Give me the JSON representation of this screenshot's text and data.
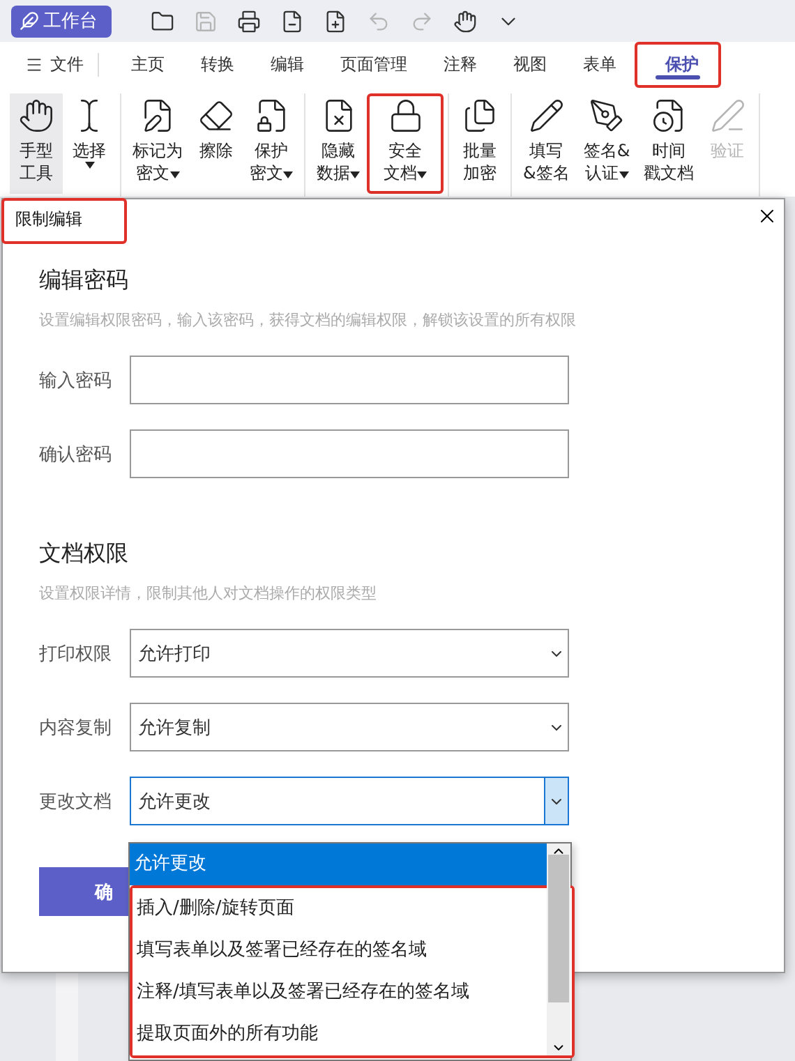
{
  "quick_toolbar": {
    "workbench": "工作台",
    "tools": [
      {
        "kind": "folder",
        "disabled": false
      },
      {
        "kind": "save",
        "disabled": true
      },
      {
        "kind": "print",
        "disabled": false
      },
      {
        "kind": "file",
        "disabled": false
      },
      {
        "kind": "file-plus",
        "disabled": false
      },
      {
        "kind": "undo",
        "disabled": true
      },
      {
        "kind": "redo",
        "disabled": true
      },
      {
        "kind": "hand",
        "disabled": false
      },
      {
        "kind": "more",
        "disabled": false
      }
    ]
  },
  "menu": {
    "file": "文件",
    "tabs": [
      {
        "label": "主页",
        "selected": false,
        "highlighted": false
      },
      {
        "label": "转换",
        "selected": false,
        "highlighted": false
      },
      {
        "label": "编辑",
        "selected": false,
        "highlighted": false
      },
      {
        "label": "页面管理",
        "selected": false,
        "highlighted": false
      },
      {
        "label": "注释",
        "selected": false,
        "highlighted": false
      },
      {
        "label": "视图",
        "selected": false,
        "highlighted": false
      },
      {
        "label": "表单",
        "selected": false,
        "highlighted": false
      },
      {
        "label": "保护",
        "selected": true,
        "highlighted": true
      }
    ]
  },
  "ribbon_groups": [
    {
      "items": [
        {
          "kind": "hand",
          "lines": [
            "手型",
            "工具"
          ],
          "has_menu": false,
          "selected": true,
          "disabled": false,
          "highlighted": false
        },
        {
          "kind": "select",
          "lines": [
            "选择"
          ],
          "has_menu": true,
          "selected": false,
          "disabled": false,
          "highlighted": false
        }
      ]
    },
    {
      "items": [
        {
          "kind": "redact",
          "lines": [
            "标记为",
            "密文"
          ],
          "has_menu": true,
          "selected": false,
          "disabled": false,
          "highlighted": false
        },
        {
          "kind": "erase",
          "lines": [
            "擦除"
          ],
          "has_menu": false,
          "selected": false,
          "disabled": false,
          "highlighted": false
        },
        {
          "kind": "protect",
          "lines": [
            "保护",
            "密文"
          ],
          "has_menu": true,
          "selected": false,
          "disabled": false,
          "highlighted": false
        }
      ]
    },
    {
      "items": [
        {
          "kind": "hide",
          "lines": [
            "隐藏",
            "数据"
          ],
          "has_menu": true,
          "selected": false,
          "disabled": false,
          "highlighted": false
        },
        {
          "kind": "lock",
          "lines": [
            "安全",
            "文档"
          ],
          "has_menu": true,
          "selected": false,
          "disabled": false,
          "highlighted": true
        }
      ]
    },
    {
      "items": [
        {
          "kind": "batch",
          "lines": [
            "批量",
            "加密"
          ],
          "has_menu": false,
          "selected": false,
          "disabled": false,
          "highlighted": false
        }
      ]
    },
    {
      "items": [
        {
          "kind": "fill",
          "lines": [
            "填写",
            "&签名"
          ],
          "has_menu": false,
          "selected": false,
          "disabled": false,
          "highlighted": false
        },
        {
          "kind": "sign",
          "lines": [
            "签名&",
            "认证"
          ],
          "has_menu": true,
          "selected": false,
          "disabled": false,
          "highlighted": false
        },
        {
          "kind": "timestamp",
          "lines": [
            "时间",
            "戳文档"
          ],
          "has_menu": false,
          "selected": false,
          "disabled": false,
          "highlighted": false
        },
        {
          "kind": "verify",
          "lines": [
            "验证"
          ],
          "has_menu": false,
          "selected": false,
          "disabled": true,
          "highlighted": false
        }
      ]
    }
  ],
  "dialog": {
    "title": "限制编辑",
    "title_highlighted": true,
    "password_section": {
      "heading": "编辑密码",
      "description": "设置编辑权限密码，输入该密码，获得文档的编辑权限，解锁该设置的所有权限",
      "fields": [
        {
          "label": "输入密码"
        },
        {
          "label": "确认密码"
        }
      ]
    },
    "permission_section": {
      "heading": "文档权限",
      "description": "设置权限详情，限制其他人对文档操作的权限类型",
      "selects": [
        {
          "label": "打印权限",
          "value": "允许打印",
          "expanded": false
        },
        {
          "label": "内容复制",
          "value": "允许复制",
          "expanded": false
        },
        {
          "label": "更改文档",
          "value": "允许更改",
          "expanded": true
        }
      ]
    },
    "confirm_button": "确",
    "dropdown_options": [
      {
        "label": "允许更改",
        "selected": true,
        "highlighted": false
      },
      {
        "label": "插入/删除/旋转页面",
        "selected": false,
        "highlighted": true
      },
      {
        "label": "填写表单以及签署已经存在的签名域",
        "selected": false,
        "highlighted": true
      },
      {
        "label": "注释/填写表单以及签署已经存在的签名域",
        "selected": false,
        "highlighted": true
      },
      {
        "label": "提取页面外的所有功能",
        "selected": false,
        "highlighted": true
      }
    ]
  }
}
